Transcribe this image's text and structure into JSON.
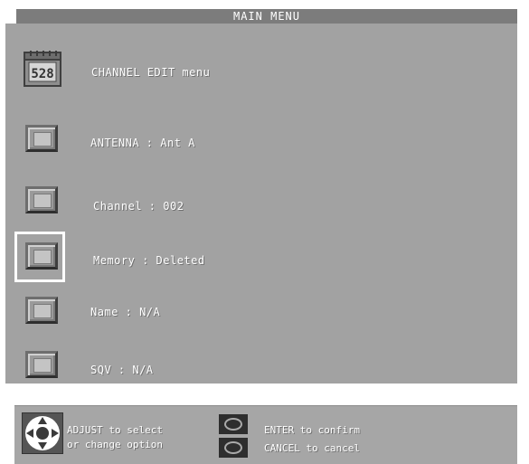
{
  "title": "MAIN MENU",
  "menu": {
    "header_item": {
      "label": "CHANNEL EDIT menu",
      "icon": "528",
      "icon_name": "calendar-icon"
    },
    "items": [
      {
        "label": "ANTENNA : Ant A",
        "selected": false
      },
      {
        "label": "Channel : 002",
        "selected": false
      },
      {
        "label": "Memory : Deleted",
        "selected": true
      },
      {
        "label": "Name : N/A",
        "selected": false
      },
      {
        "label": "SQV : N/A",
        "selected": false
      }
    ]
  },
  "footer": {
    "adjust_line1": "ADJUST to select",
    "adjust_line2": "or change option",
    "enter_hint": "ENTER to confirm",
    "cancel_hint": "CANCEL to cancel"
  },
  "colors": {
    "title_bar": "#7c7c7c",
    "panel": "#a2a2a2",
    "text": "#ffffff",
    "selection": "#ffffff"
  }
}
